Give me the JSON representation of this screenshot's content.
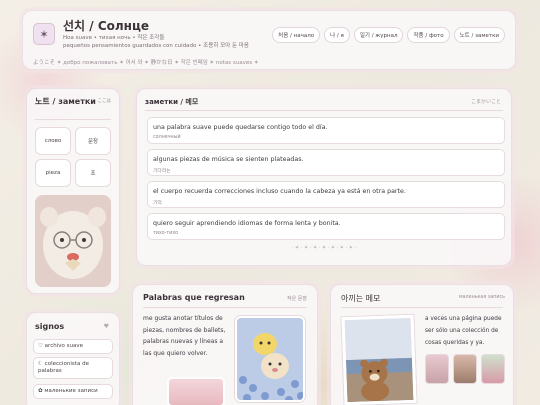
{
  "header": {
    "avatar_glyph": "✶",
    "title": "선치 / Солнце",
    "subtitle": "Hoa suave • тихая ночь • 작은 조각들",
    "subtitle2": "pequeños pensamientos guardados con cuidado • 조용히 모아 둔 마음",
    "ticker": "ようこそ ✶ добро пожаловать ✶ 어서 와 ✶ 静かな日 ✶ 작은 빈페임 ✶ notas suaves ✶",
    "nav": [
      "처음 / начало",
      "나 / я",
      "일기 / журнал",
      "작품 / фото",
      "노트 / заметки"
    ]
  },
  "notes": {
    "title": "노트 / заметки",
    "small": "ここは",
    "words": [
      "слово",
      "문장",
      "pieza",
      "조"
    ]
  },
  "signos": {
    "title": "signos",
    "icon": "heart-icon",
    "items": [
      "♡ archivo suave",
      "☾ coleccionista de palabras",
      "✿ маленькие записи"
    ]
  },
  "memo": {
    "title": "заметки / 메모",
    "deco": "こまかいこと",
    "items": [
      {
        "text": "una palabra suave puede quedarse contigo todo el día.",
        "tag": "солнечный"
      },
      {
        "text": "algunas piezas de música se sienten plateadas.",
        "tag": "기다리는"
      },
      {
        "text": "el cuerpo recuerda correcciones incluso cuando la cabeza ya está en otra parte.",
        "tag": "기억"
      },
      {
        "text": "quiero seguir aprendiendo idiomas de forma lenta y bonita.",
        "tag": "тихо-тихо"
      }
    ],
    "footer": "· ✶ · ✶ · ✶ · ✶ · ✶ · ✶ · ✶ ·"
  },
  "palabras": {
    "title": "Palabras que regresan",
    "tag": "작은 문장",
    "text": "me gusta anotar títulos de piezas, nombres de ballets, palabras nuevas y líneas a las que quiero volver."
  },
  "memo2": {
    "title": "아끼는 메모",
    "tag": "маленькая запись",
    "text": "a veces una página puede ser sólo una colección de cosas queridas y ya."
  }
}
